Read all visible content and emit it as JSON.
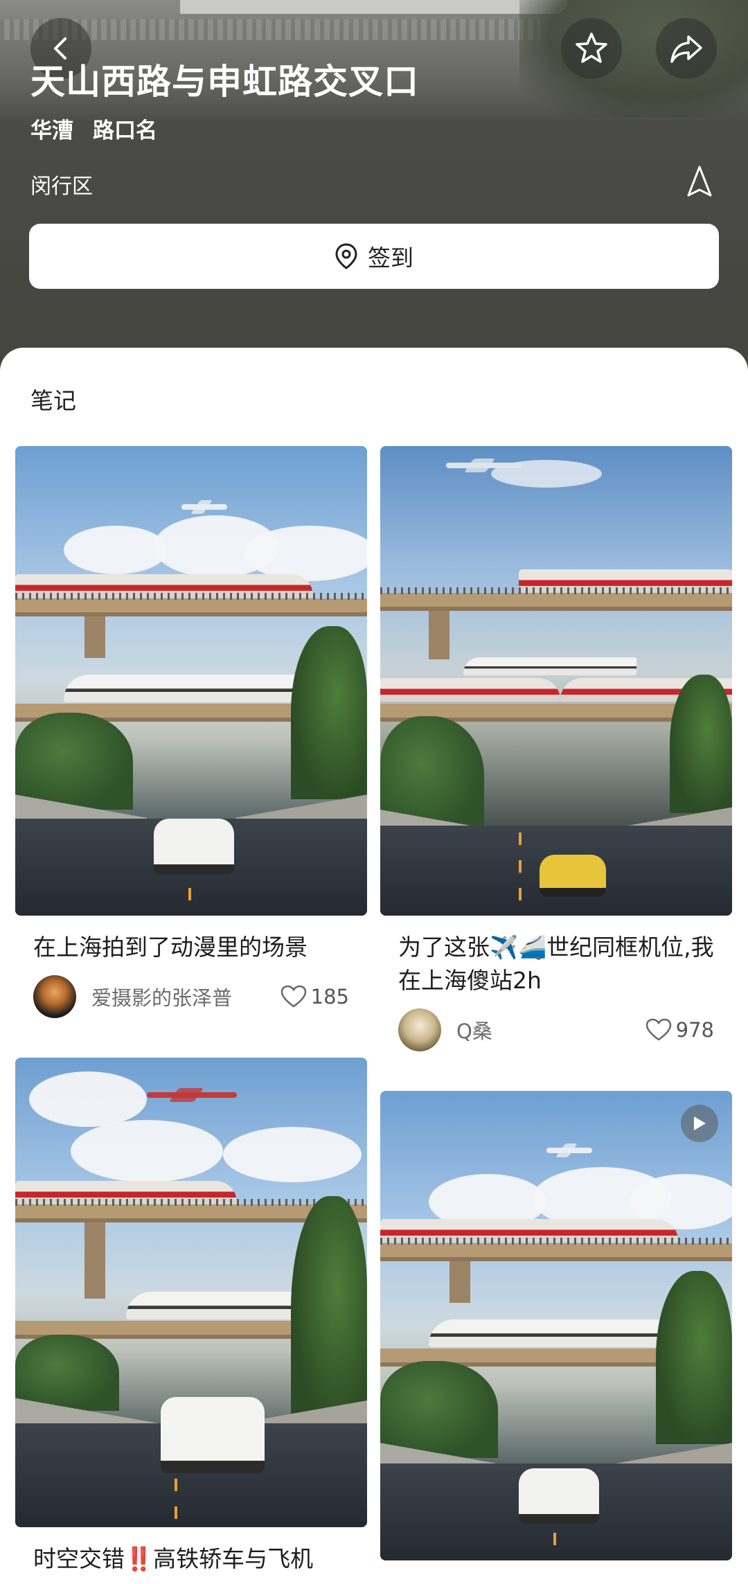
{
  "header": {
    "title": "天山西路与申虹路交叉口",
    "tags": [
      "华漕",
      "路口名"
    ],
    "district": "闵行区",
    "checkin_label": "签到",
    "icons": {
      "back": "chevron-left-icon",
      "favorite": "star-icon",
      "share": "share-icon",
      "navigate": "navigation-arrow-icon",
      "checkin": "location-pin-icon"
    }
  },
  "notes": {
    "section_title": "笔记",
    "cards": [
      {
        "title": "在上海拍到了动漫里的场景",
        "author": "爱摄影的张泽普",
        "likes": "185",
        "has_video": false
      },
      {
        "title": "为了这张✈️🚄世纪同框机位,我在上海傻站2h",
        "author": "Q桑",
        "likes": "978",
        "has_video": false
      },
      {
        "title": "时空交错‼️高铁轿车与飞机",
        "author": "",
        "likes": "",
        "has_video": false
      },
      {
        "title": "",
        "author": "",
        "likes": "",
        "has_video": true
      }
    ]
  },
  "colors": {
    "header_bg": "#4a4a47",
    "train_red": "#c8262c",
    "sky_blue": "#6e9fd2",
    "lane_yellow": "#e7a13a"
  }
}
